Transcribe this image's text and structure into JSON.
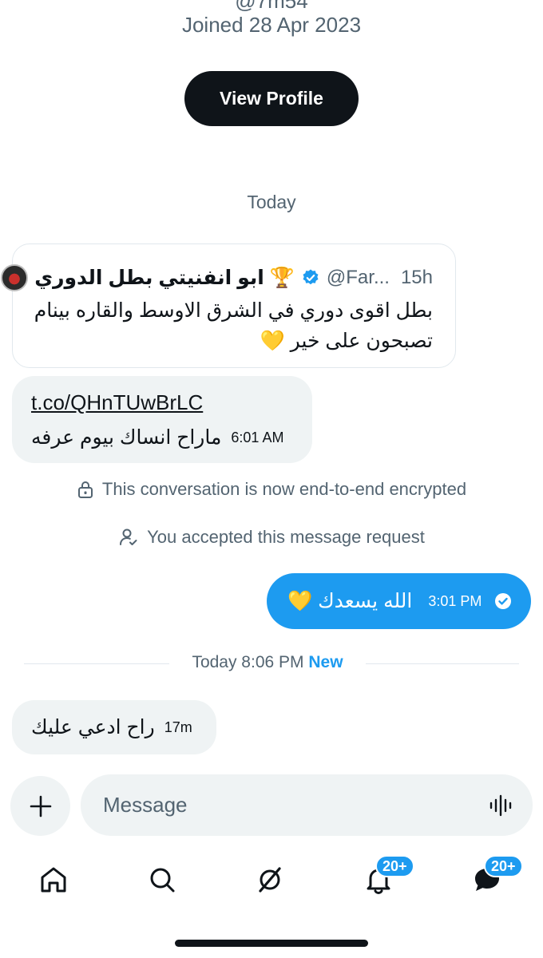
{
  "profile": {
    "handle_partial": "@7m54",
    "joined": "Joined 28 Apr 2023",
    "view_profile_label": "View Profile"
  },
  "date_separator": "Today",
  "quoted_post": {
    "name": "ابو انفنيتي بطل الدوري 🏆",
    "handle": "@Far...",
    "time": "15h",
    "text": "بطل اقوى دوري في الشرق الاوسط والقاره بينام تصبحون على خير 💛"
  },
  "incoming_1": {
    "link": "t.co/QHnTUwBrLC",
    "text": "ماراح انساك بيوم عرفه",
    "time": "6:01 AM"
  },
  "system_messages": {
    "encrypted": "This conversation is now end-to-end encrypted",
    "accepted": "You accepted this message request"
  },
  "outgoing_1": {
    "text": "الله يسعدك 💛",
    "time": "3:01 PM"
  },
  "new_divider": {
    "time": "Today 8:06 PM",
    "new_label": "New"
  },
  "incoming_2": {
    "text": "راح ادعي عليك",
    "time": "17m"
  },
  "composer": {
    "placeholder": "Message"
  },
  "nav": {
    "notifications_badge": "20+",
    "messages_badge": "20+"
  },
  "colors": {
    "accent": "#1d9bf0",
    "text": "#0f1419",
    "secondary": "#536471",
    "bubble_bg": "#eff3f4"
  }
}
